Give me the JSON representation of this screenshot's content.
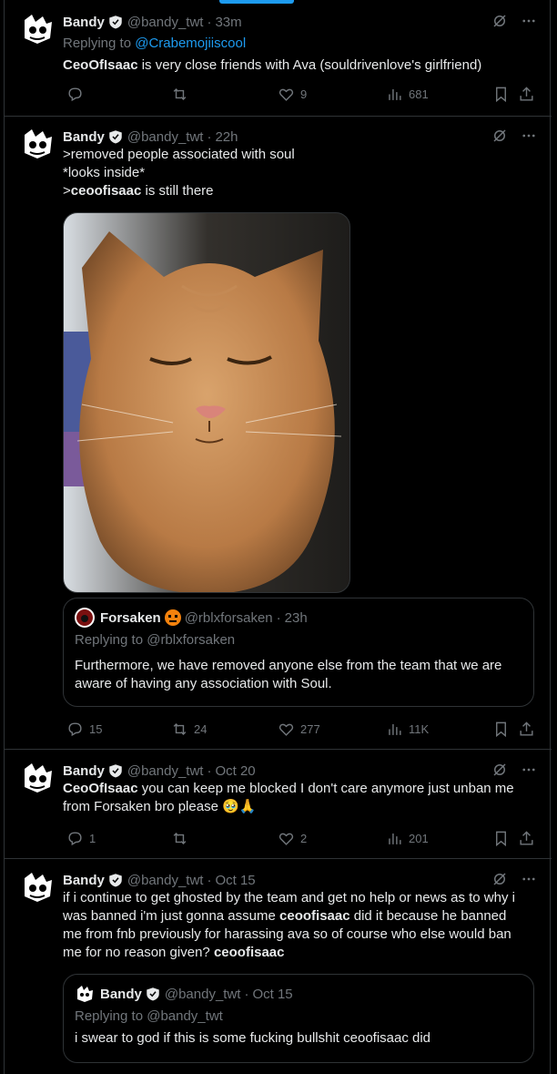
{
  "tweets": [
    {
      "name": "Bandy",
      "handle": "@bandy_twt",
      "time": "33m",
      "replying_prefix": "Replying to",
      "replying_to": "@Crabemojiiscool",
      "text_bold": "CeoOfIsaac",
      "text_rest": " is very close friends with Ava (souldrivenlove's girlfriend)",
      "replies": "",
      "reposts": "",
      "likes": "9",
      "views": "681"
    },
    {
      "name": "Bandy",
      "handle": "@bandy_twt",
      "time": "22h",
      "line1": ">removed people associated with soul",
      "line2": "*looks inside*",
      "line3_prefix": ">",
      "line3_bold": "ceoofisaac",
      "line3_rest": " is still there",
      "photo_alt": "cat-photo",
      "quote": {
        "name": "Forsaken",
        "handle": "@rblxforsaken",
        "time": "23h",
        "replying": "Replying to @rblxforsaken",
        "text": "Furthermore, we have removed anyone else from the team that we are aware of having any association with Soul."
      },
      "replies": "15",
      "reposts": "24",
      "likes": "277",
      "views": "11K"
    },
    {
      "name": "Bandy",
      "handle": "@bandy_twt",
      "time": "Oct 20",
      "text_bold": "CeoOfIsaac",
      "text_rest1": " you can keep me blocked I don't care anymore just unban me",
      "text_line2": "from Forsaken bro please ",
      "emoji": "🥹🙏",
      "replies": "1",
      "reposts": "",
      "likes": "2",
      "views": "201"
    },
    {
      "name": "Bandy",
      "handle": "@bandy_twt",
      "time": "Oct 15",
      "l1": "if i continue to get ghosted by the team and get no help or news as to why i",
      "l2_pre": "was banned i'm just gonna assume ",
      "l2_bold": "ceoofisaac",
      "l2_post": " did it because he banned",
      "l3": "me from fnb previously for harassing ava so of course who else would ban",
      "l4_pre": "me for no reason given? ",
      "l4_bold": "ceoofisaac",
      "quote": {
        "name": "Bandy",
        "handle": "@bandy_twt",
        "time": "Oct 15",
        "replying": "Replying to @bandy_twt",
        "text": "i swear to god if this is some fucking bullshit ceoofisaac did"
      }
    }
  ],
  "colors": {
    "accent": "#1d9bf0",
    "muted": "#71767b",
    "border": "#2f3336",
    "bg": "#000000"
  },
  "icons": [
    "reply-icon",
    "repost-icon",
    "like-icon",
    "views-icon",
    "bookmark-icon",
    "share-icon",
    "grok-icon",
    "more-icon",
    "verified-icon"
  ]
}
